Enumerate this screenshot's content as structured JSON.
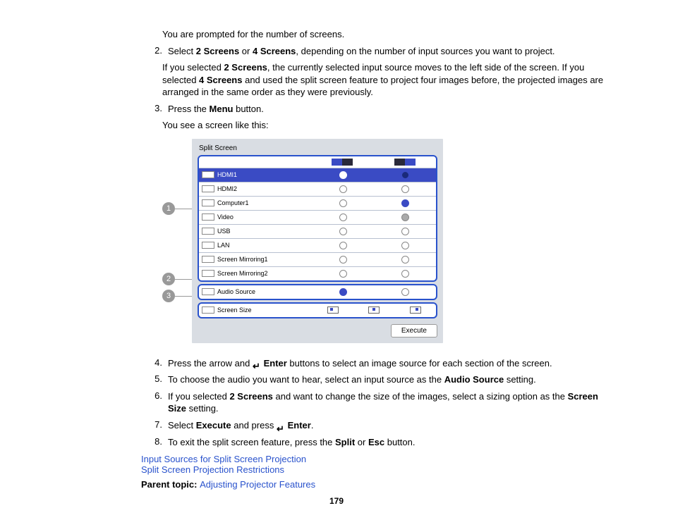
{
  "intro": "You are prompted for the number of screens.",
  "steps": {
    "s2": {
      "num": "2.",
      "text1": "Select ",
      "b1": "2 Screens",
      "text2": " or ",
      "b2": "4 Screens",
      "text3": ", depending on the number of input sources you want to project.",
      "sub1a": "If you selected ",
      "sub1b": "2 Screens",
      "sub1c": ", the currently selected input source moves to the left side of the screen. If you selected ",
      "sub1d": "4 Screens",
      "sub1e": " and used the split screen feature to project four images before, the projected images are arranged in the same order as they were previously."
    },
    "s3": {
      "num": "3.",
      "text1": "Press the ",
      "b1": "Menu",
      "text2": " button.",
      "sub": "You see a screen like this:"
    },
    "s4": {
      "num": "4.",
      "text1": "Press the arrow and ",
      "b1": "Enter",
      "text2": " buttons to select an image source for each section of the screen."
    },
    "s5": {
      "num": "5.",
      "text1": "To choose the audio you want to hear, select an input source as the ",
      "b1": "Audio Source",
      "text2": " setting."
    },
    "s6": {
      "num": "6.",
      "text1": "If you selected ",
      "b1": "2 Screens",
      "text2": " and want to change the size of the images, select a sizing option as the ",
      "b2": "Screen Size",
      "text3": " setting."
    },
    "s7": {
      "num": "7.",
      "text1": "Select ",
      "b1": "Execute",
      "text2": " and press ",
      "b2": "Enter",
      "text3": "."
    },
    "s8": {
      "num": "8.",
      "text1": "To exit the split screen feature, press the ",
      "b1": "Split",
      "text2": " or ",
      "b2": "Esc",
      "text3": " button."
    }
  },
  "callouts": {
    "c1": "1",
    "c2": "2",
    "c3": "3"
  },
  "panel": {
    "title": "Split Screen",
    "rows": [
      "HDMI1",
      "HDMI2",
      "Computer1",
      "Video",
      "USB",
      "LAN",
      "Screen Mirroring1",
      "Screen Mirroring2"
    ],
    "audio": "Audio Source",
    "size": "Screen Size",
    "exec": "Execute"
  },
  "links": {
    "l1": "Input Sources for Split Screen Projection",
    "l2": "Split Screen Projection Restrictions",
    "parentLabel": "Parent topic: ",
    "parentLink": "Adjusting Projector Features"
  },
  "pagenum": "179"
}
